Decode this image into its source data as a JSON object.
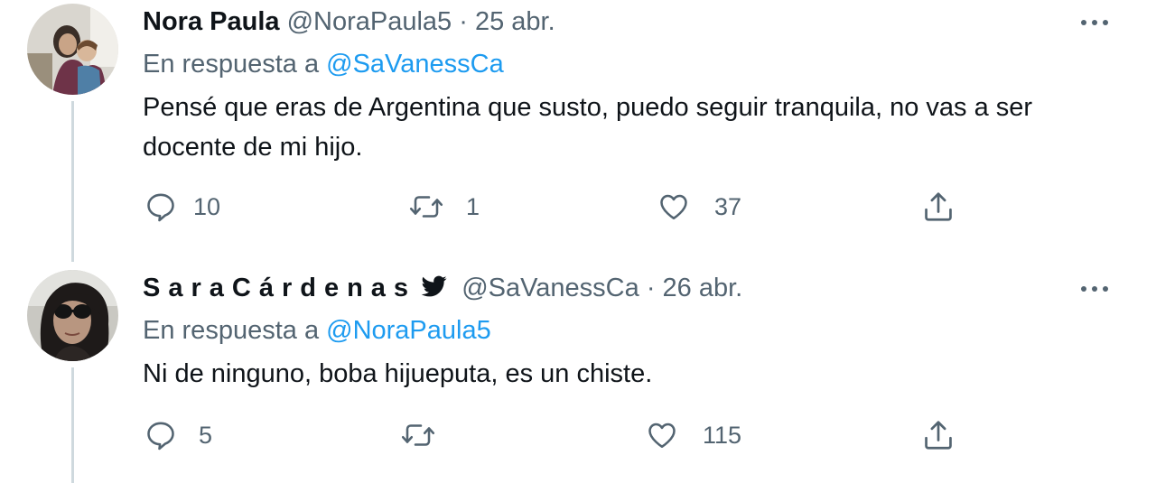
{
  "tweets": [
    {
      "author_name": "Nora Paula",
      "handle": "@NoraPaula5",
      "separator": "·",
      "date": "25 abr.",
      "reply_prefix": "En respuesta a",
      "reply_to": "@SaVanessCa",
      "text": "Pensé que eras de Argentina que susto, puedo seguir tranquila, no vas a ser docente de mi hijo.",
      "replies": "10",
      "retweets": "1",
      "likes": "37",
      "verified": false
    },
    {
      "author_name": "SaraCárdenas",
      "handle": "@SaVanessCa",
      "separator": "·",
      "date": "26 abr.",
      "reply_prefix": "En respuesta a",
      "reply_to": "@NoraPaula5",
      "text": "Ni de ninguno, boba hijueputa, es un chiste.",
      "replies": "5",
      "retweets": "",
      "likes": "115",
      "verified": false
    }
  ],
  "colors": {
    "text": "#0f1419",
    "secondary": "#536471",
    "link": "#1d9bf0",
    "thread_line": "#cfd9de"
  },
  "icons": {
    "reply": "speech-bubble-icon",
    "retweet": "retweet-arrows-icon",
    "like": "heart-icon",
    "share": "share-upload-icon",
    "more": "more-dots-icon",
    "badge": "bird-icon"
  }
}
